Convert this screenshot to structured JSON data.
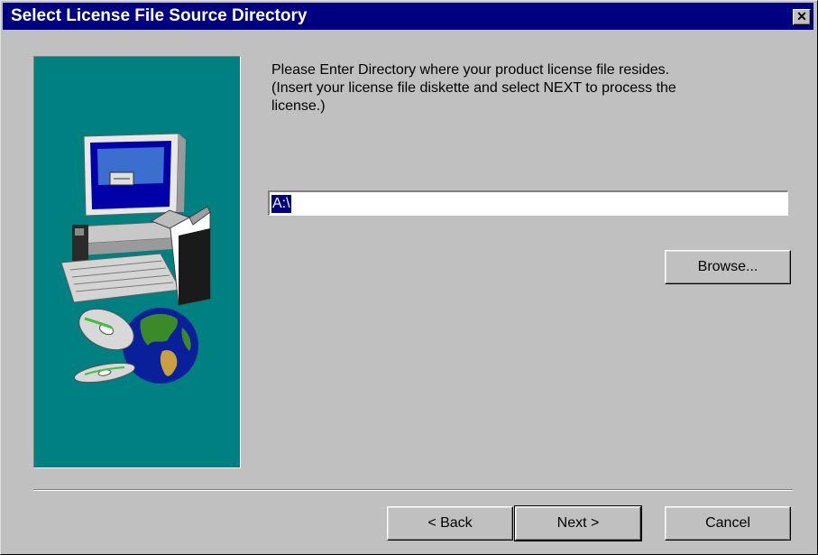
{
  "window": {
    "title": "Select License File Source Directory",
    "close_glyph": "✕"
  },
  "content": {
    "instructions": "Please Enter Directory where your product license file resides.\n(Insert your license file diskette and select NEXT to process the\nlicense.)",
    "directory_value": "A:\\"
  },
  "buttons": {
    "browse": "Browse...",
    "back": "< Back",
    "next": "Next >",
    "cancel": "Cancel"
  },
  "colors": {
    "titlebar": "#000080",
    "panel": "#008080",
    "face": "#c0c0c0"
  },
  "icons": [
    "computer-illustration",
    "globe-icon",
    "cd-disc-icon",
    "close-icon"
  ]
}
